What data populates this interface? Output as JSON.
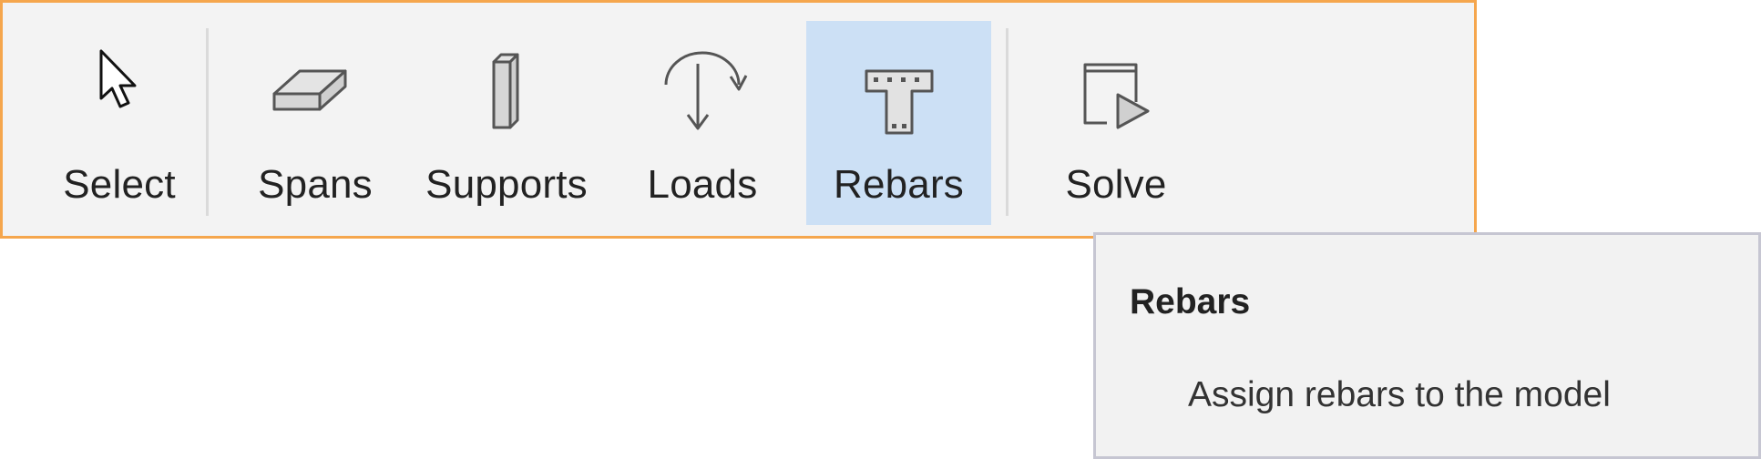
{
  "toolbar": {
    "tools": [
      {
        "label": "Select",
        "icon": "cursor-arrow-icon"
      },
      {
        "label": "Spans",
        "icon": "beam-slab-icon"
      },
      {
        "label": "Supports",
        "icon": "column-support-icon"
      },
      {
        "label": "Loads",
        "icon": "load-arrow-icon"
      },
      {
        "label": "Rebars",
        "icon": "rebar-section-icon",
        "active": true
      },
      {
        "label": "Solve",
        "icon": "solve-play-icon"
      }
    ]
  },
  "tooltip": {
    "title": "Rebars",
    "description": "Assign rebars to the model"
  },
  "colors": {
    "toolbar_border": "#f5a64d",
    "toolbar_bg": "#f3f3f3",
    "active_bg": "#cce0f5",
    "tooltip_border": "#c6c6d2",
    "tooltip_bg": "#f2f2f2"
  }
}
